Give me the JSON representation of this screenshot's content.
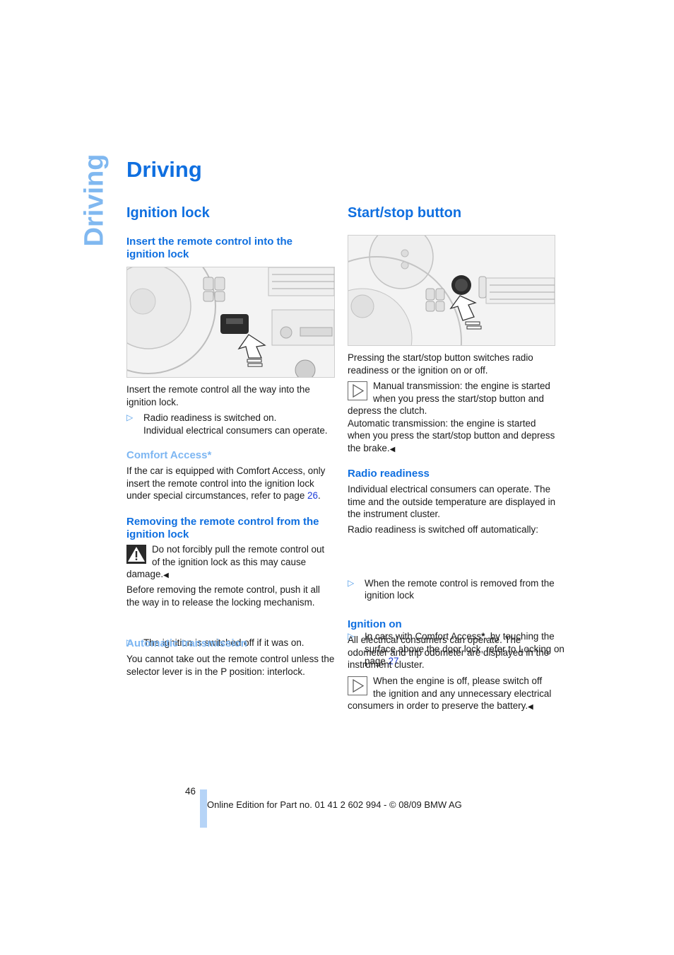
{
  "side_tab": "Driving",
  "page_title": "Driving",
  "left": {
    "heading": "Ignition lock",
    "subheading_insert": "Insert the remote control into the ignition lock",
    "image_alt": "Steering wheel with remote control inserted in ignition lock, arrow pointing",
    "insert_text": "Insert the remote control all the way into the ignition lock.",
    "insert_bullet_line1": "Radio readiness is switched on.",
    "insert_bullet_line2": "Individual electrical consumers can operate.",
    "comfort_heading": "Comfort Access*",
    "comfort_text_pre": "If the car is equipped with Comfort Access, only insert the remote control into the ignition lock under special circumstances, refer to page ",
    "comfort_page_link": "26",
    "comfort_text_post": ".",
    "removing_heading": "Removing the remote control from the ignition lock",
    "warning_text": "Do not forcibly pull the remote control out of the ignition lock as this may cause damage.",
    "before_removing_text": "Before removing the remote control, push it all the way in to release the locking mechanism.",
    "removing_bullet": "The ignition is switched off if it was on.",
    "auto_heading": "Automatic transmission",
    "auto_text": "You cannot take out the remote control unless the selector lever is in the P position: interlock."
  },
  "right": {
    "heading": "Start/stop button",
    "image_alt": "Steering wheel with start/stop button, arrow pointing",
    "intro_text": "Pressing the start/stop button switches radio readiness or the ignition on or off.",
    "note_manual": "Manual transmission: the engine is started when you press the start/stop button and depress the clutch.",
    "note_auto": "Automatic transmission: the engine is started when you press the start/stop button and depress the brake.",
    "radio_heading": "Radio readiness",
    "radio_text": "Individual electrical consumers can operate. The time and the outside temperature are displayed in the instrument cluster.",
    "radio_off_text": "Radio readiness is switched off automatically:",
    "radio_bullet1": "When the remote control is removed from the ignition lock",
    "radio_bullet2_pre": "In cars with Comfort Access",
    "radio_bullet2_star": "*",
    "radio_bullet2_mid": ", by touching the surface above the door lock, refer to Locking on page ",
    "radio_bullet2_link": "27",
    "ign_heading": "Ignition on",
    "ign_text": "All electrical consumers can operate. The odometer and trip odometer are displayed in the instrument cluster.",
    "ign_note": "When the engine is off, please switch off the ignition and any unnecessary electrical consumers in order to preserve the battery."
  },
  "symbols": {
    "bullet": "▷",
    "end_mark": "◀"
  },
  "footer": {
    "page_number": "46",
    "edition_text": "Online Edition for Part no. 01 41 2 602 994 - © 08/09 BMW AG"
  },
  "colors": {
    "heading_blue": "#0f6fe0",
    "light_blue": "#7db6f2",
    "link_blue": "#1a3bd8",
    "footer_bar": "#b6d4f7"
  }
}
